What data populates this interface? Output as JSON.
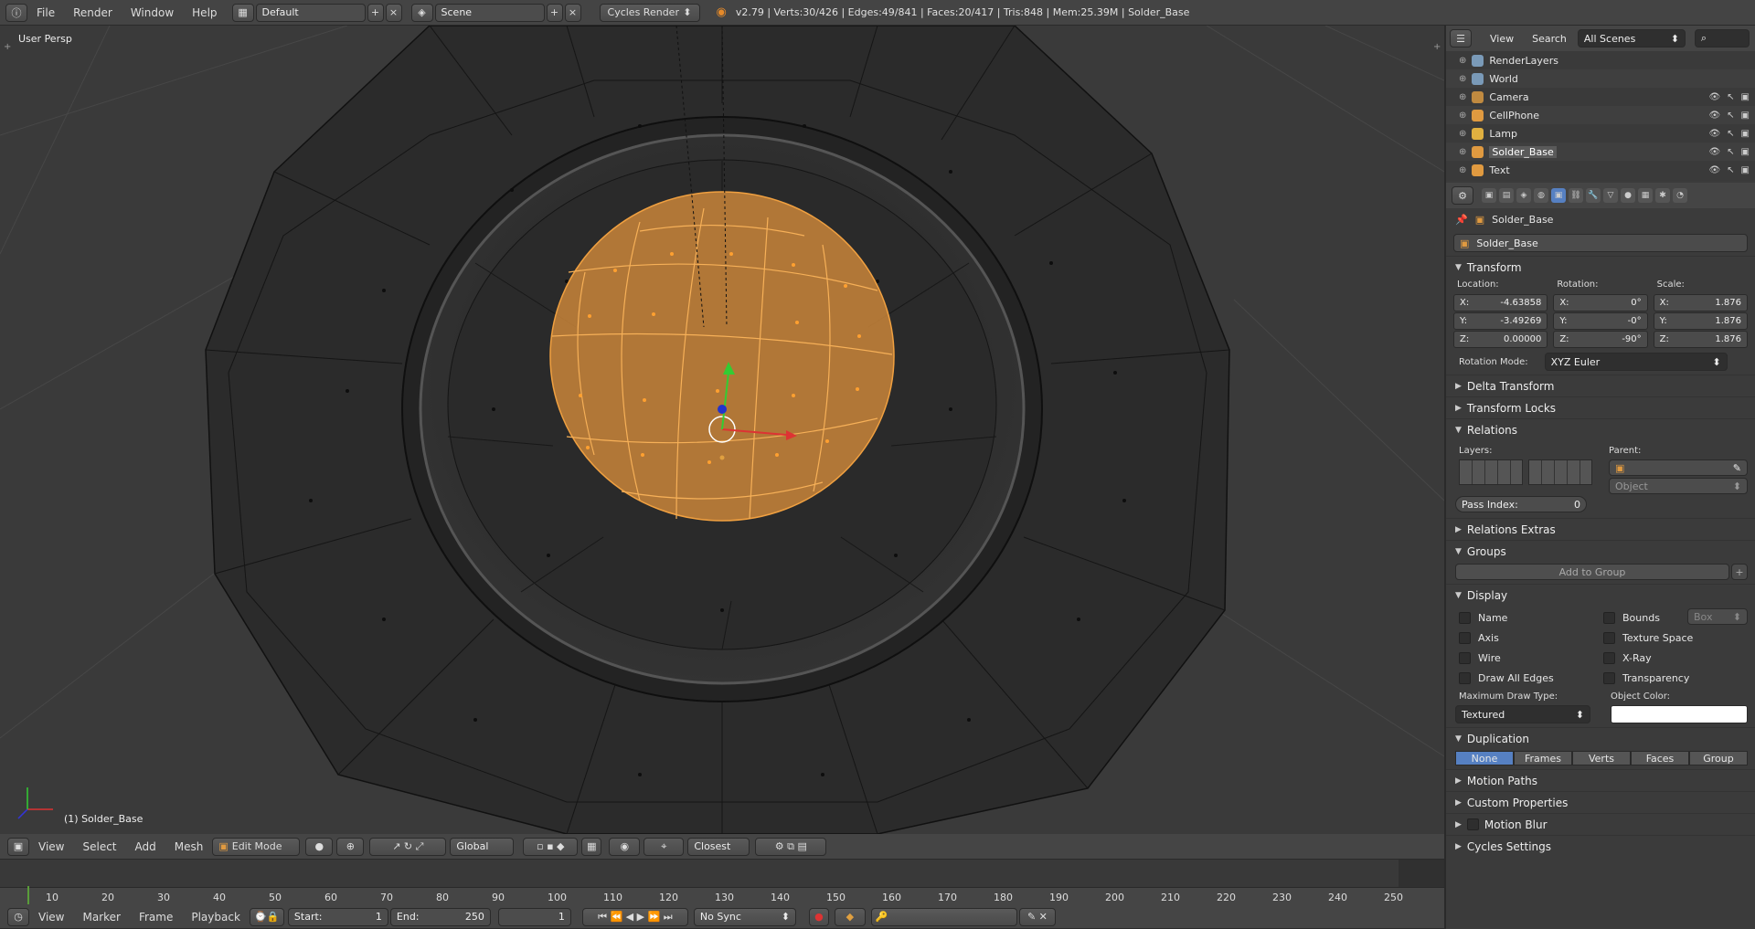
{
  "topbar": {
    "menus": [
      "File",
      "Render",
      "Window",
      "Help"
    ],
    "screen_layout": "Default",
    "scene": "Scene",
    "render_engine": "Cycles Render",
    "stats": "v2.79 | Verts:30/426 | Edges:49/841 | Faces:20/417 | Tris:848 | Mem:25.39M | Solder_Base"
  },
  "viewport": {
    "view_name": "User Persp",
    "object_label": "(1) Solder_Base",
    "selection_color": "#f0a040",
    "header": {
      "menus": [
        "View",
        "Select",
        "Add",
        "Mesh"
      ],
      "mode": "Edit Mode",
      "orientation": "Global",
      "snap_target": "Closest"
    }
  },
  "timeline": {
    "ticks": [
      "10",
      "20",
      "30",
      "40",
      "50",
      "60",
      "70",
      "80",
      "90",
      "100",
      "110",
      "120",
      "130",
      "140",
      "150",
      "160",
      "170",
      "180",
      "190",
      "200",
      "210",
      "220",
      "230",
      "240",
      "250"
    ],
    "menus": [
      "View",
      "Marker",
      "Frame",
      "Playback"
    ],
    "start_label": "Start:",
    "start": "1",
    "end_label": "End:",
    "end": "250",
    "current": "1",
    "sync": "No Sync"
  },
  "outliner": {
    "menus": [
      "View",
      "Search"
    ],
    "filter": "All Scenes",
    "items": [
      {
        "name": "RenderLayers",
        "icon": "renderlayers-icon",
        "color": "#7a9ab8"
      },
      {
        "name": "World",
        "icon": "world-icon",
        "color": "#7a9ab8"
      },
      {
        "name": "Camera",
        "icon": "camera-icon",
        "color": "#c08a40"
      },
      {
        "name": "CellPhone",
        "icon": "mesh-icon",
        "color": "#e09a40"
      },
      {
        "name": "Lamp",
        "icon": "lamp-icon",
        "color": "#e0b040"
      },
      {
        "name": "Solder_Base",
        "icon": "mesh-icon",
        "color": "#e09a40",
        "selected": true
      },
      {
        "name": "Text",
        "icon": "text-icon",
        "color": "#e09a40"
      }
    ]
  },
  "properties": {
    "breadcrumb": "Solder_Base",
    "object_name": "Solder_Base",
    "transform": {
      "title": "Transform",
      "location_label": "Location:",
      "rotation_label": "Rotation:",
      "scale_label": "Scale:",
      "location": [
        {
          "axis": "X:",
          "value": "-4.63858"
        },
        {
          "axis": "Y:",
          "value": "-3.49269"
        },
        {
          "axis": "Z:",
          "value": "0.00000"
        }
      ],
      "rotation": [
        {
          "axis": "X:",
          "value": "0°"
        },
        {
          "axis": "Y:",
          "value": "-0°"
        },
        {
          "axis": "Z:",
          "value": "-90°"
        }
      ],
      "scale": [
        {
          "axis": "X:",
          "value": "1.876"
        },
        {
          "axis": "Y:",
          "value": "1.876"
        },
        {
          "axis": "Z:",
          "value": "1.876"
        }
      ],
      "rotation_mode_label": "Rotation Mode:",
      "rotation_mode": "XYZ Euler"
    },
    "delta_transform": "Delta Transform",
    "transform_locks": "Transform Locks",
    "relations": {
      "title": "Relations",
      "layers_label": "Layers:",
      "parent_label": "Parent:",
      "parent_type": "Object",
      "pass_index_label": "Pass Index:",
      "pass_index": "0"
    },
    "relations_extras": "Relations Extras",
    "groups": {
      "title": "Groups",
      "add_button": "Add to Group"
    },
    "display": {
      "title": "Display",
      "left": [
        "Name",
        "Axis",
        "Wire",
        "Draw All Edges"
      ],
      "right": [
        "Bounds",
        "Texture Space",
        "X-Ray",
        "Transparency"
      ],
      "bounds_type": "Box",
      "max_draw_type_label": "Maximum Draw Type:",
      "max_draw_type": "Textured",
      "object_color_label": "Object Color:"
    },
    "duplication": {
      "title": "Duplication",
      "options": [
        "None",
        "Frames",
        "Verts",
        "Faces",
        "Group"
      ],
      "selected": "None"
    },
    "collapsed": [
      "Motion Paths",
      "Custom Properties",
      "Motion Blur",
      "Cycles Settings"
    ]
  }
}
